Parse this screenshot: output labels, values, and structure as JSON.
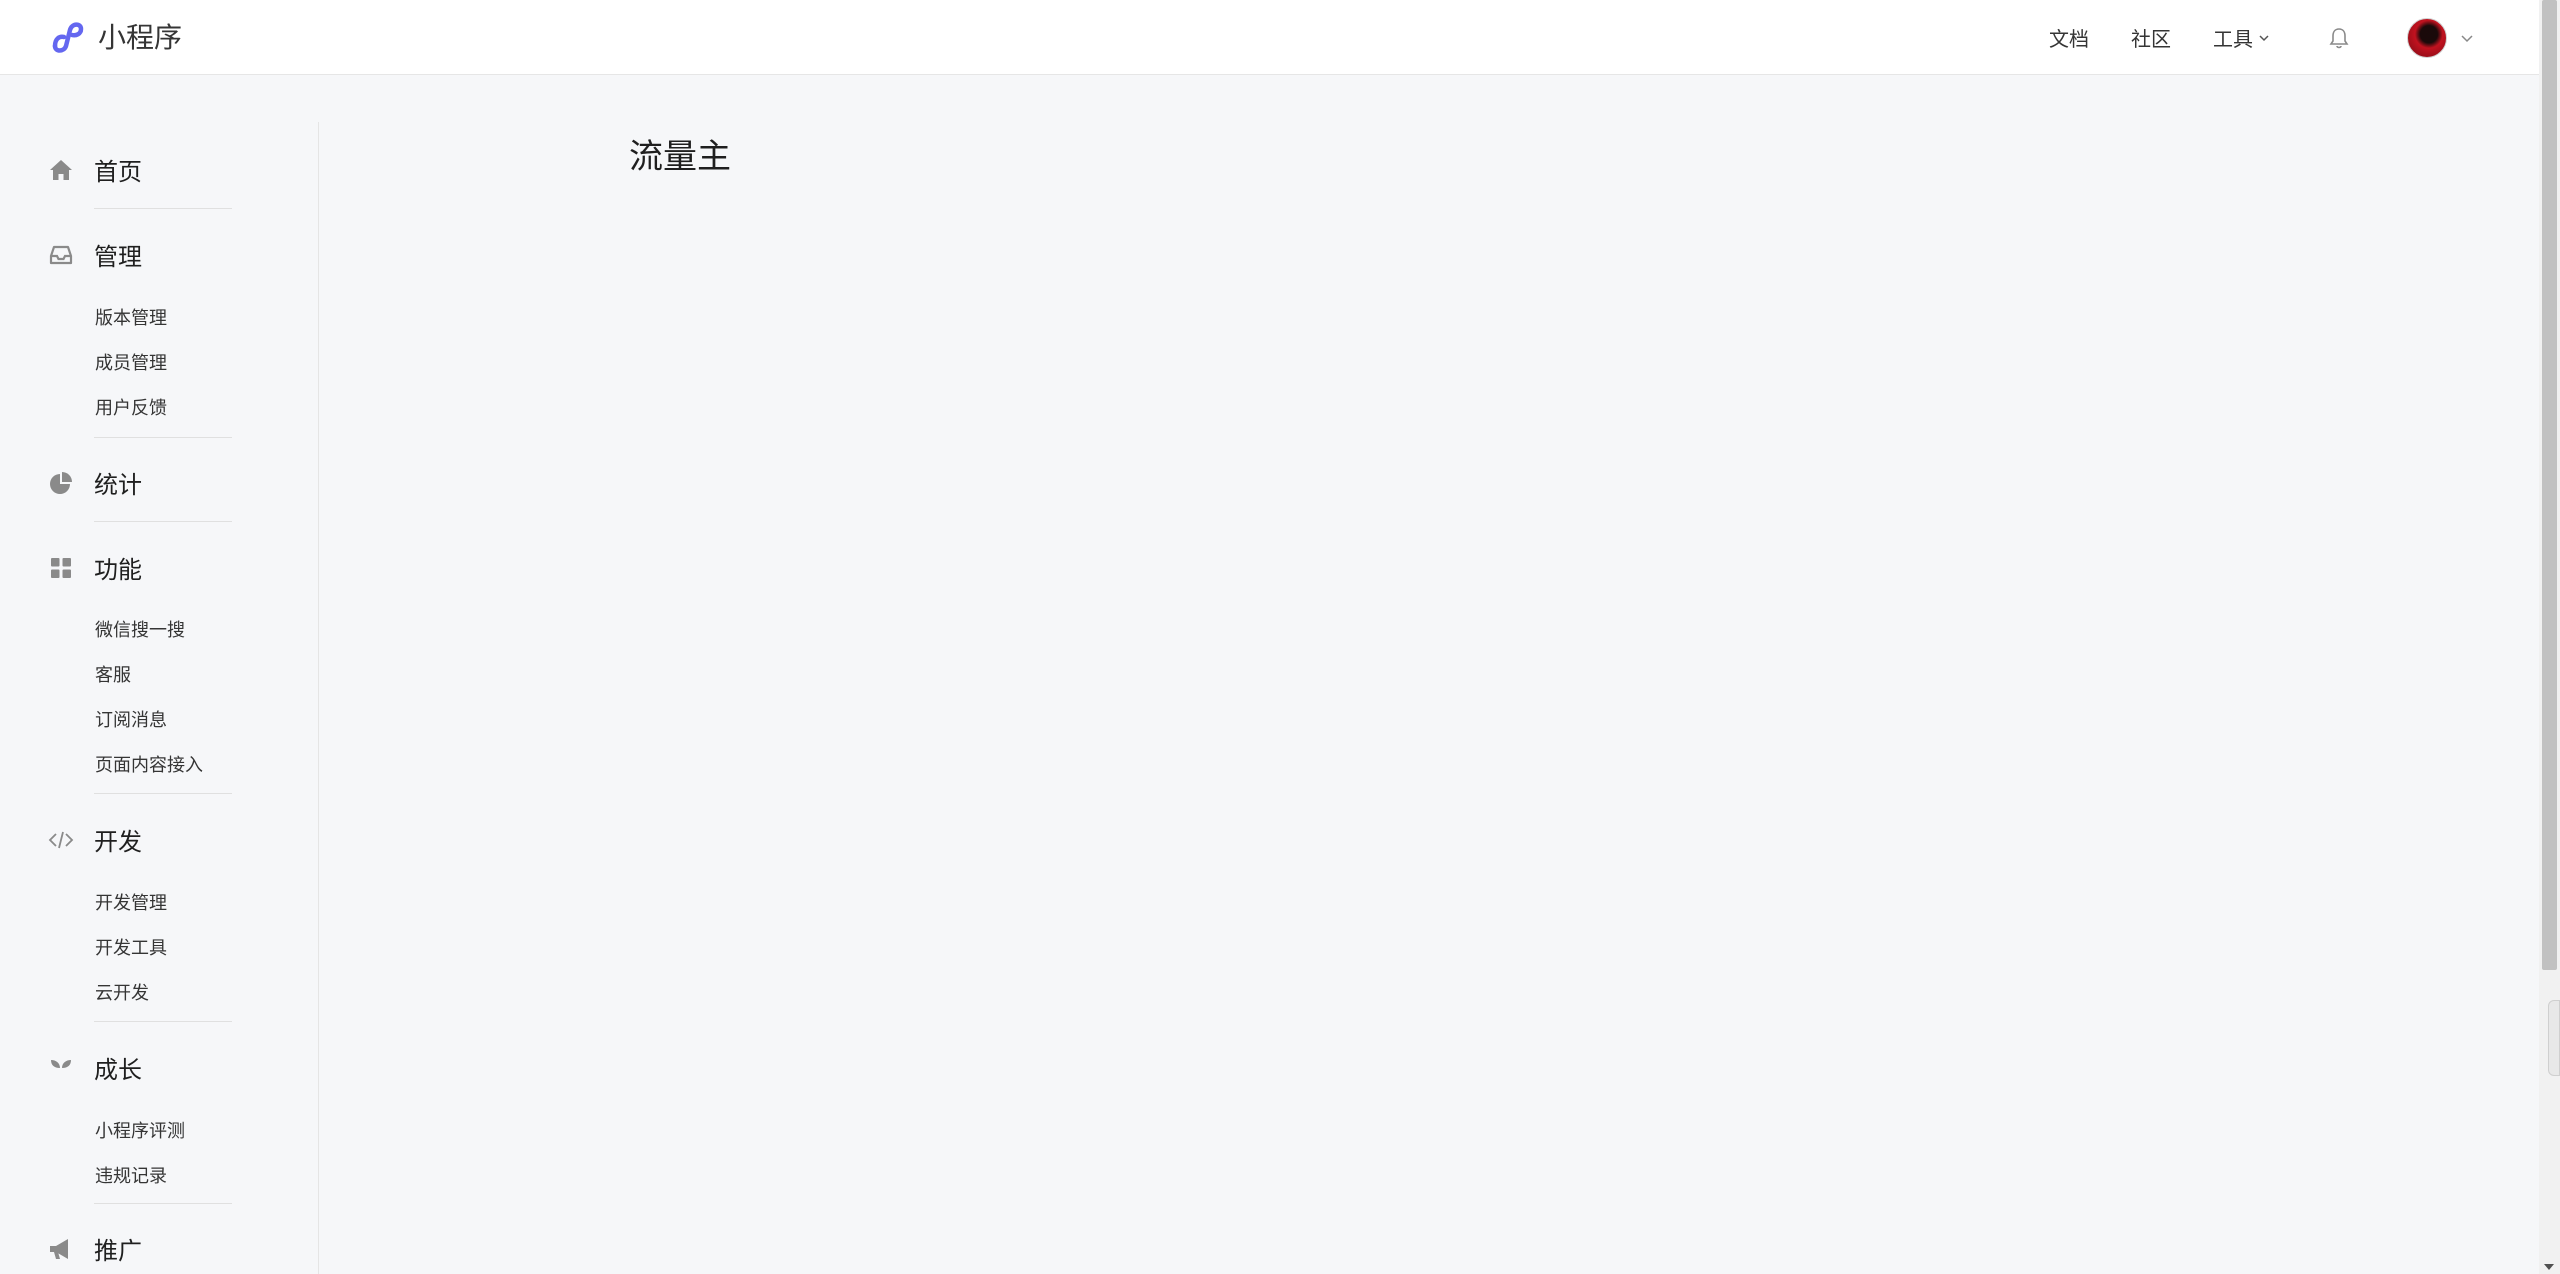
{
  "header": {
    "brand_title": "小程序",
    "brand_icon": "mini-program-logo",
    "nav": {
      "docs": "文档",
      "community": "社区",
      "tools": "工具"
    },
    "bell_icon": "bell-icon",
    "accent": "#6467f0"
  },
  "sidebar": {
    "home": "首页",
    "manage": {
      "label": "管理",
      "items": [
        "版本管理",
        "成员管理",
        "用户反馈"
      ]
    },
    "stats": "统计",
    "features": {
      "label": "功能",
      "items": [
        "微信搜一搜",
        "客服",
        "订阅消息",
        "页面内容接入"
      ]
    },
    "develop": {
      "label": "开发",
      "items": [
        "开发管理",
        "开发工具",
        "云开发"
      ]
    },
    "growth": {
      "label": "成长",
      "items": [
        "小程序评测",
        "违规记录"
      ]
    },
    "promote": "推广"
  },
  "main": {
    "title": "流量主"
  }
}
